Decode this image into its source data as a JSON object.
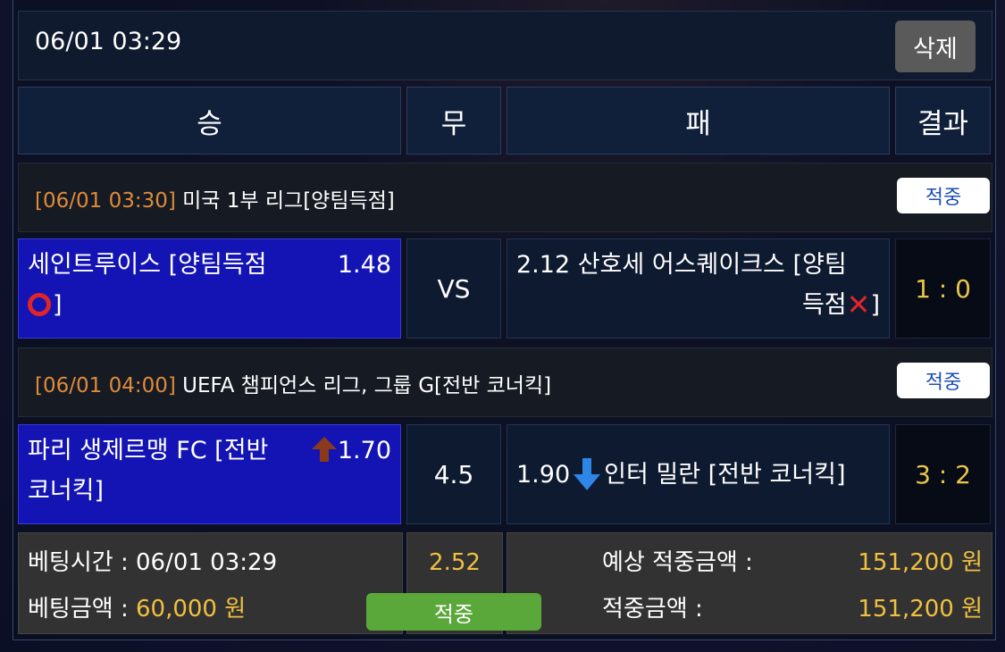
{
  "header": {
    "datetime": "06/01 03:29",
    "delete_label": "삭제"
  },
  "columns": {
    "win": "승",
    "draw": "무",
    "lose": "패",
    "result": "결과"
  },
  "games": [
    {
      "time": "[06/01 03:30]",
      "league": "미국 1부 리그[양팀득점]",
      "status": "적중",
      "home_name": "세인트루이스 [양팀득점",
      "home_suffix": "]",
      "home_odd": "1.48",
      "mid": "VS",
      "away_odd": "2.12",
      "away_name_line1": "산호세 어스퀘이크스 [양팀",
      "away_name_line2a": "득점",
      "away_name_line2b": "]",
      "score": "1 : 0"
    },
    {
      "time": "[06/01 04:00]",
      "league": "UEFA 챔피언스 리그, 그룹 G[전반 코너킥]",
      "status": "적중",
      "home_name_line1": "파리 생제르맹 FC [전반",
      "home_name_line2": "코너킥]",
      "home_odd": "1.70",
      "mid": "4.5",
      "away_odd": "1.90",
      "away_name": "인터 밀란 [전반 코너킥]",
      "score": "3 : 2"
    }
  ],
  "footer": {
    "bet_time_label": "베팅시간 : ",
    "bet_time": "06/01 03:29",
    "bet_amount_label": "베팅금액 : ",
    "bet_amount": "60,000 원",
    "total_odds": "2.52",
    "hit_label": "적중",
    "expected_label": "예상 적중금액 :",
    "expected_value": "151,200 원",
    "won_label": "적중금액 :",
    "won_value": "151,200 원"
  },
  "icons": {
    "selected_mark": "red-circle-icon",
    "unselected_mark": "red-x-icon",
    "odds_up": "arrow-up-icon",
    "odds_down": "arrow-down-icon"
  },
  "colors": {
    "home_bg": "#1414b4",
    "time_orange": "#e08a3a",
    "gold": "#f0c040",
    "hit_green": "#5aa83a"
  }
}
